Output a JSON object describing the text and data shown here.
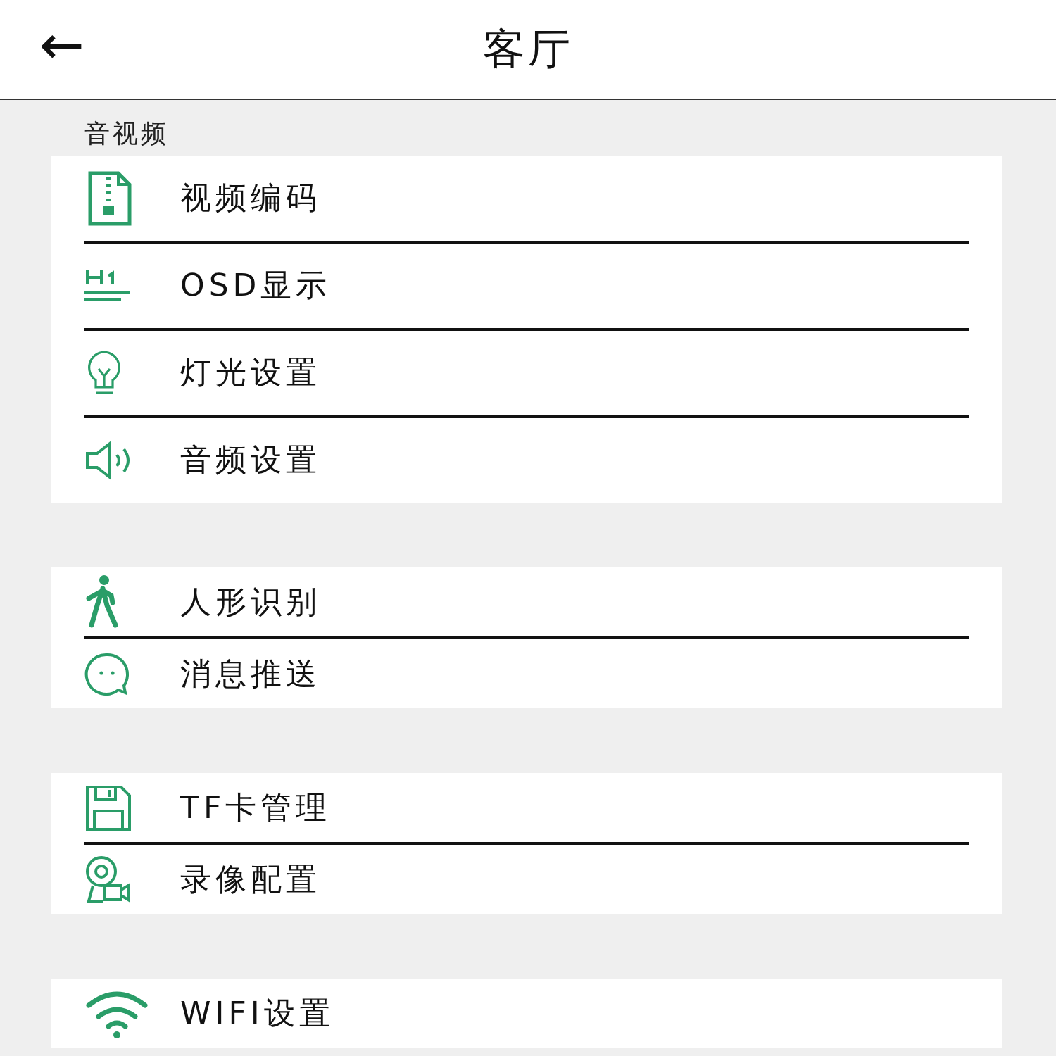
{
  "header": {
    "back_icon": "←",
    "title": "客厅"
  },
  "sections": [
    {
      "title": "音视频",
      "items": [
        {
          "kind": "zip",
          "label": "视频编码"
        },
        {
          "kind": "heading",
          "label": "OSD显示"
        },
        {
          "kind": "bulb",
          "label": "灯光设置"
        },
        {
          "kind": "speaker",
          "label": "音频设置"
        }
      ]
    },
    {
      "items": [
        {
          "kind": "walker",
          "label": "人形识别"
        },
        {
          "kind": "chat",
          "label": "消息推送"
        }
      ]
    },
    {
      "items": [
        {
          "kind": "floppy",
          "label": "TF卡管理"
        },
        {
          "kind": "camera",
          "label": "录像配置"
        }
      ]
    },
    {
      "items": [
        {
          "kind": "wifi",
          "label": "WIFI设置"
        }
      ]
    }
  ]
}
